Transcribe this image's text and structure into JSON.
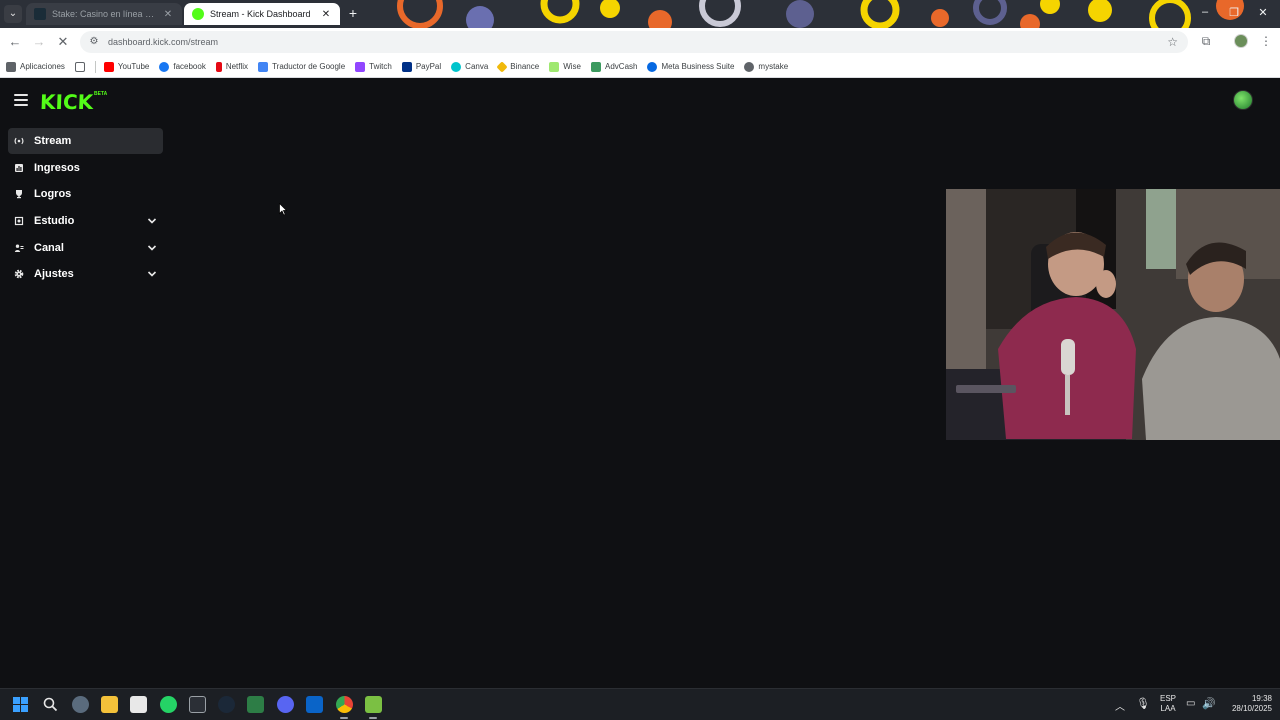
{
  "browser": {
    "tabs": [
      {
        "title": "Stake: Casino en línea y Apuest",
        "active": false
      },
      {
        "title": "Stream - Kick Dashboard",
        "active": true
      }
    ],
    "url": "dashboard.kick.com/stream",
    "bookmarks": [
      {
        "label": "Aplicaciones",
        "icon": "apps-icon",
        "color": "#5f6368"
      },
      {
        "label": "YouTube",
        "icon": "youtube-icon",
        "color": "#ff0000"
      },
      {
        "label": "facebook",
        "icon": "facebook-icon",
        "color": "#1877f2"
      },
      {
        "label": "Netflix",
        "icon": "netflix-icon",
        "color": "#e50914"
      },
      {
        "label": "Traductor de Google",
        "icon": "translate-icon",
        "color": "#4285f4"
      },
      {
        "label": "Twitch",
        "icon": "twitch-icon",
        "color": "#9146ff"
      },
      {
        "label": "PayPal",
        "icon": "paypal-icon",
        "color": "#003087"
      },
      {
        "label": "Canva",
        "icon": "canva-icon",
        "color": "#00c4cc"
      },
      {
        "label": "Binance",
        "icon": "binance-icon",
        "color": "#f0b90b"
      },
      {
        "label": "Wise",
        "icon": "wise-icon",
        "color": "#9fe870"
      },
      {
        "label": "AdvCash",
        "icon": "advcash-icon",
        "color": "#3c9a5f"
      },
      {
        "label": "Meta Business Suite",
        "icon": "meta-icon",
        "color": "#0668e1"
      },
      {
        "label": "mystake",
        "icon": "mystake-icon",
        "color": "#5f6368"
      }
    ]
  },
  "app": {
    "logo": "KICK",
    "logo_badge": "BETA",
    "accent": "#53fc18",
    "sidebar": [
      {
        "label": "Stream",
        "icon": "broadcast-icon",
        "active": true,
        "expandable": false
      },
      {
        "label": "Ingresos",
        "icon": "chart-icon",
        "active": false,
        "expandable": false
      },
      {
        "label": "Logros",
        "icon": "trophy-icon",
        "active": false,
        "expandable": false
      },
      {
        "label": "Estudio",
        "icon": "studio-icon",
        "active": false,
        "expandable": true
      },
      {
        "label": "Canal",
        "icon": "channel-icon",
        "active": false,
        "expandable": true
      },
      {
        "label": "Ajustes",
        "icon": "gear-icon",
        "active": false,
        "expandable": true
      }
    ]
  },
  "taskbar": {
    "language": "ESP",
    "layout": "LAA",
    "time": "19:38",
    "date": "28/10/2025"
  }
}
